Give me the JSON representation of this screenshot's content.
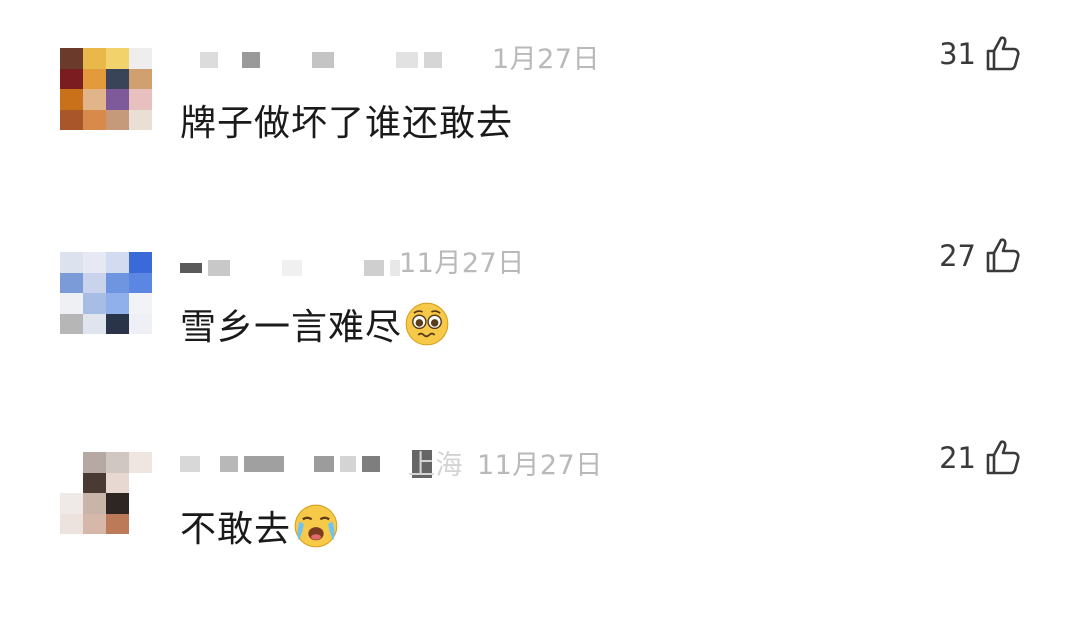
{
  "comments": [
    {
      "date": "1月27日",
      "text": "牌子做坏了谁还敢去",
      "likes": "31",
      "emoji": null
    },
    {
      "date": "11月27日",
      "text": "雪乡一言难尽",
      "likes": "27",
      "emoji": "pleading-face-icon"
    },
    {
      "location_fragment": "上海",
      "date": "11月27日",
      "text": "不敢去",
      "likes": "21",
      "emoji": "loudly-crying-face-icon"
    }
  ],
  "colors": {
    "text": "#1a1a1a",
    "meta": "#b9b9b9",
    "like": "#3a3a3a",
    "emoji_yellow": "#f7c948"
  }
}
